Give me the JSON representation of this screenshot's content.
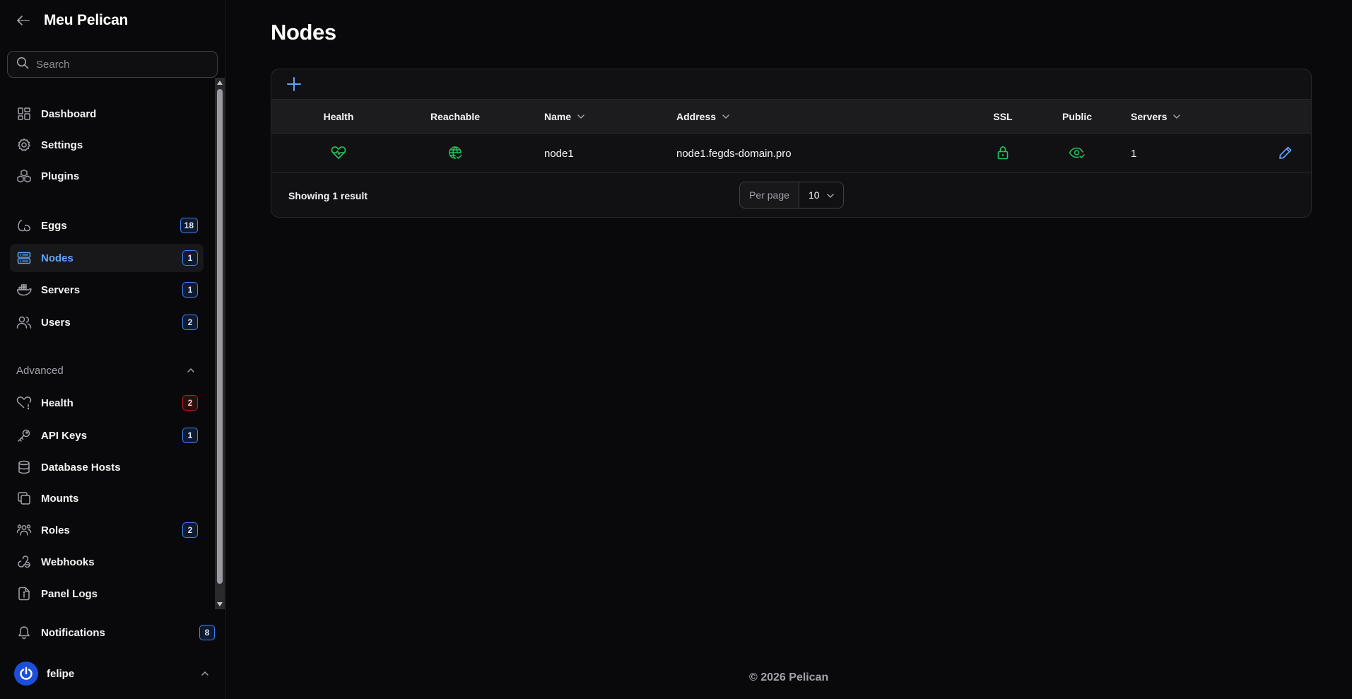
{
  "sidebar": {
    "brand": "Meu Pelican",
    "search_placeholder": "Search",
    "items": [
      {
        "label": "Dashboard"
      },
      {
        "label": "Settings"
      },
      {
        "label": "Plugins"
      },
      {
        "label": "Eggs",
        "badge": "18"
      },
      {
        "label": "Nodes",
        "badge": "1"
      },
      {
        "label": "Servers",
        "badge": "1"
      },
      {
        "label": "Users",
        "badge": "2"
      }
    ],
    "advanced_label": "Advanced",
    "advanced_items": [
      {
        "label": "Health",
        "badge": "2"
      },
      {
        "label": "API Keys",
        "badge": "1"
      },
      {
        "label": "Database Hosts"
      },
      {
        "label": "Mounts"
      },
      {
        "label": "Roles",
        "badge": "2"
      },
      {
        "label": "Webhooks"
      },
      {
        "label": "Panel Logs"
      }
    ],
    "notifications": {
      "label": "Notifications",
      "badge": "8"
    },
    "user": {
      "name": "felipe"
    }
  },
  "main": {
    "title": "Nodes",
    "table": {
      "columns": {
        "health": "Health",
        "reachable": "Reachable",
        "name": "Name",
        "address": "Address",
        "ssl": "SSL",
        "public": "Public",
        "servers": "Servers"
      },
      "rows": [
        {
          "name": "node1",
          "address": "node1.fegds-domain.pro",
          "servers": "1"
        }
      ],
      "showing": "Showing 1 result",
      "per_page_label": "Per page",
      "per_page_value": "10"
    },
    "footer": "© 2026 Pelican"
  },
  "colors": {
    "accent": "#3b82f6",
    "active_text": "#60a5fa",
    "success": "#22c55e",
    "danger": "#b91c1c"
  }
}
